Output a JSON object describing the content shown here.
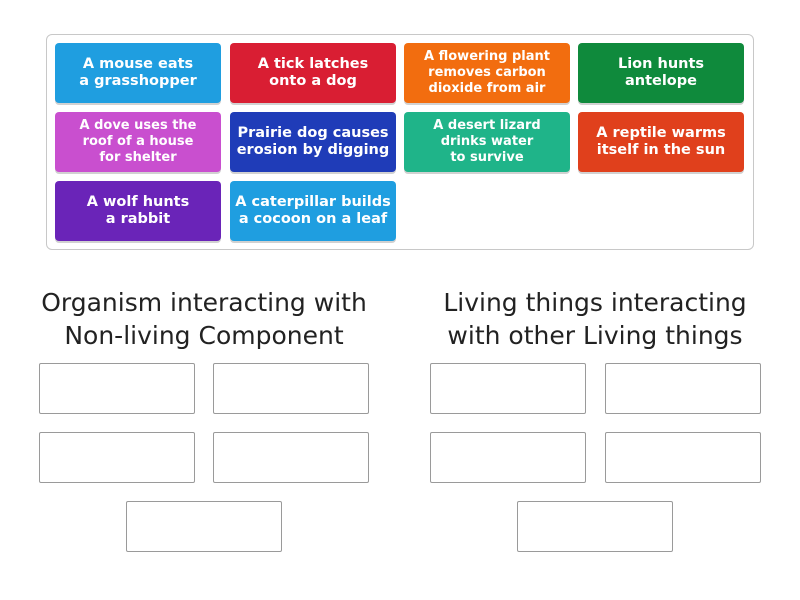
{
  "cards": [
    {
      "text": "A mouse eats\na grasshopper",
      "color": "#1f9ee0"
    },
    {
      "text": "A tick latches\nonto a dog",
      "color": "#d91e33"
    },
    {
      "text": "A flowering plant\nremoves carbon\ndioxide from air",
      "color": "#f26d0f"
    },
    {
      "text": "Lion hunts\nantelope",
      "color": "#0f8a3c"
    },
    {
      "text": "A dove uses the\nroof of a house\nfor shelter",
      "color": "#c94fcf"
    },
    {
      "text": "Prairie dog causes\nerosion by digging",
      "color": "#1f3cb8"
    },
    {
      "text": "A desert lizard\ndrinks water\nto survive",
      "color": "#1fb489"
    },
    {
      "text": "A reptile warms\nitself in the sun",
      "color": "#e0401c"
    },
    {
      "text": "A wolf hunts\na rabbit",
      "color": "#6a24b8"
    },
    {
      "text": "A caterpillar builds\na cocoon on a leaf",
      "color": "#1f9ee0"
    }
  ],
  "groups": [
    {
      "title": "Organism interacting with\nNon-living Component",
      "slot_count": 5
    },
    {
      "title": "Living things interacting\nwith other Living things",
      "slot_count": 5
    }
  ]
}
